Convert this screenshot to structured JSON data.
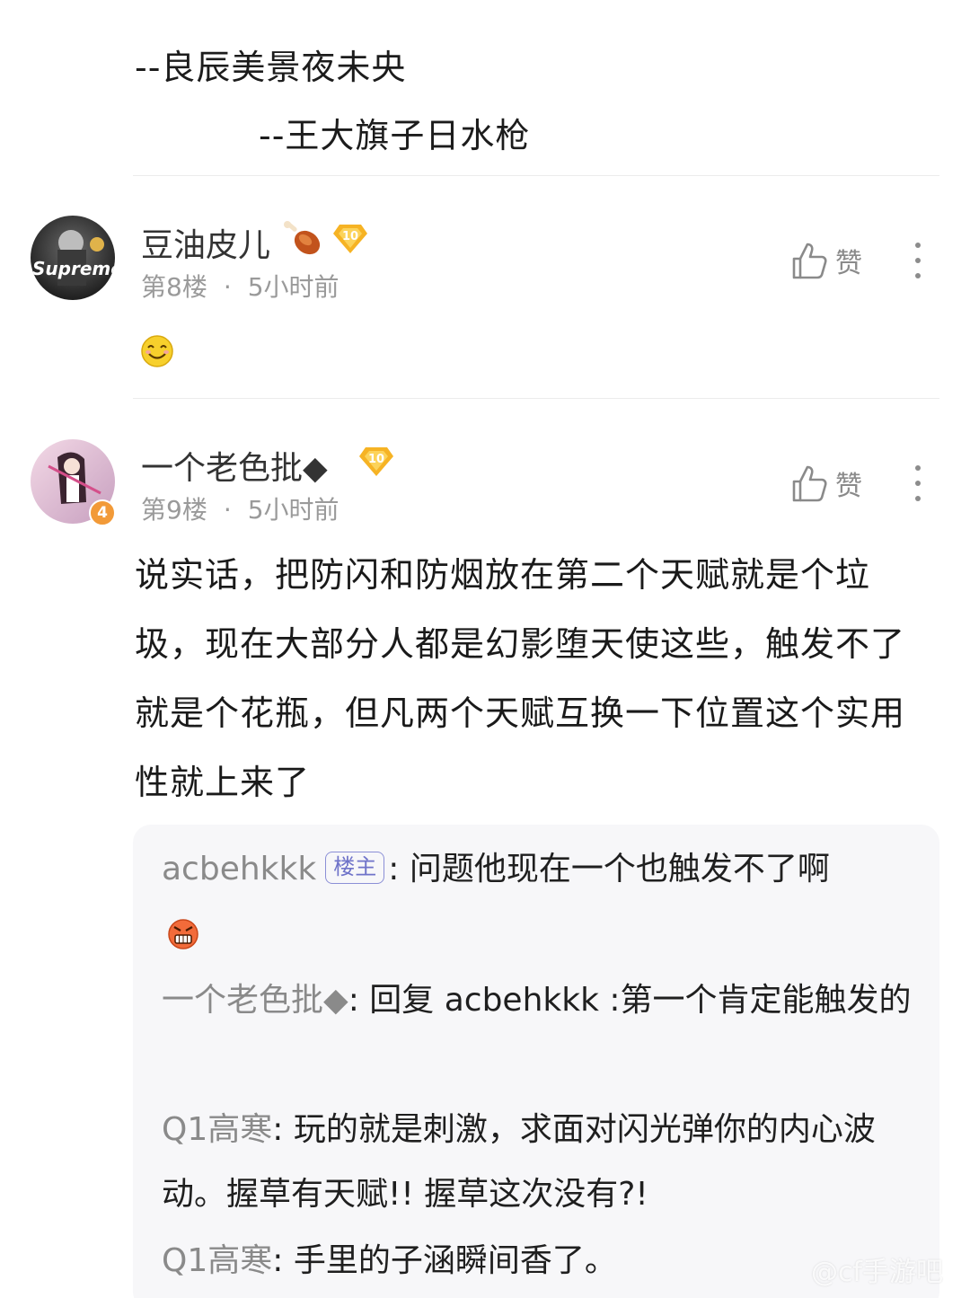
{
  "previous_post": {
    "line1": "--良辰美景夜未央",
    "line2": "--王大旗子日水枪"
  },
  "comments": [
    {
      "username": "豆油皮儿",
      "level": "10",
      "floor": "第8楼",
      "separator": "·",
      "time": "5小时前",
      "like_label": "赞",
      "avatar_text": "Supreme",
      "content_emoji": "smile-emoji"
    },
    {
      "username": "一个老色批◆",
      "level": "10",
      "avatar_badge": "4",
      "floor": "第9楼",
      "separator": "·",
      "time": "5小时前",
      "like_label": "赞",
      "content": "说实话，把防闪和防烟放在第二个天赋就是个垃圾，现在大部分人都是幻影堕天使这些，触发不了就是个花瓶，但凡两个天赋互换一下位置这个实用性就上来了",
      "replies": [
        {
          "author": "acbehkkk",
          "tag": "楼主",
          "separator": ":",
          "text": "问题他现在一个也触发不了啊"
        },
        {
          "author": "一个老色批◆",
          "separator": ":",
          "text": "回复 acbehkkk :第一个肯定能触发的"
        },
        {
          "author": "Q1高寒",
          "separator": ":",
          "text": "玩的就是刺激，求面对闪光弹你的内心波动。握草有天赋!! 握草这次没有?!"
        },
        {
          "author": "Q1高寒",
          "separator": ":",
          "text": "手里的子涵瞬间香了。"
        }
      ]
    }
  ],
  "watermark": "@cf手游吧",
  "colors": {
    "badge_gold": "#f6b324",
    "owner_tag": "#6f73c9",
    "reply_bg": "#f7f7f9"
  }
}
